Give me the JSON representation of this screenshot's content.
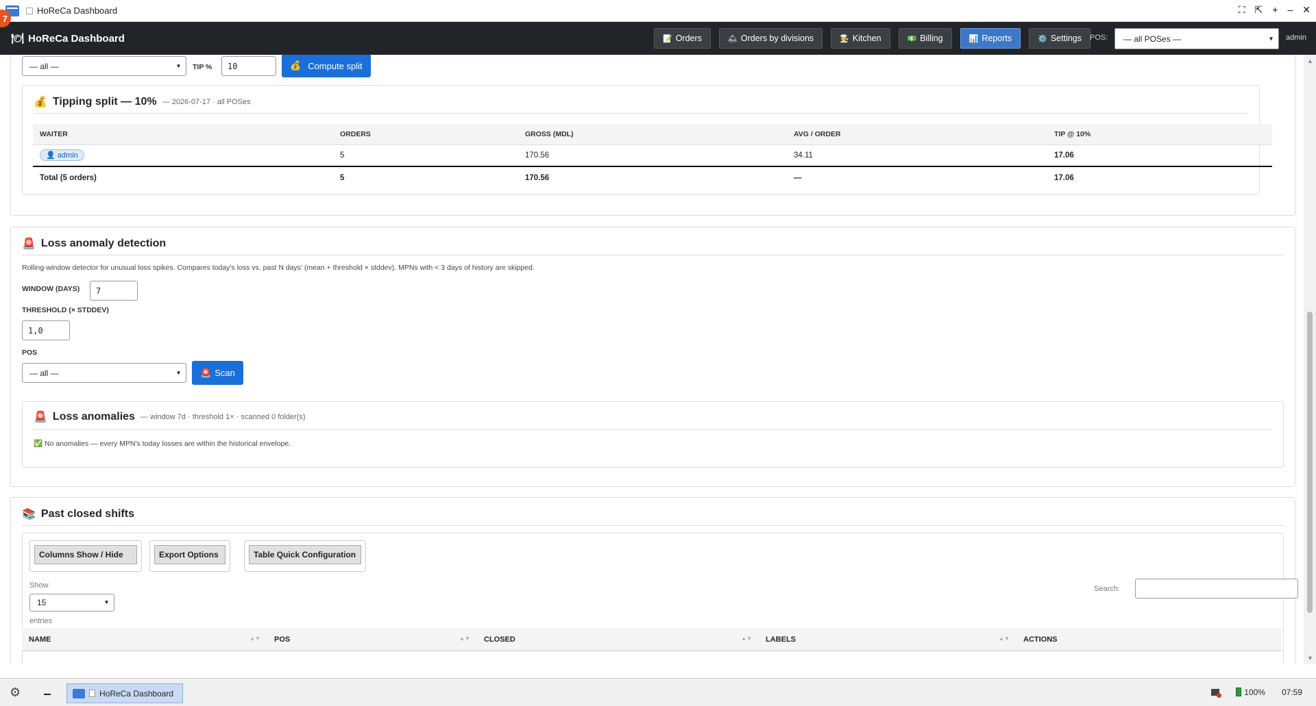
{
  "os": {
    "window_title": "HoReCa Dashboard",
    "notification_count": "7",
    "controls": [
      "⛶",
      "⇱",
      "+",
      "–",
      "✕"
    ]
  },
  "navbar": {
    "brand": "HoReCa Dashboard",
    "buttons": [
      {
        "label": "Orders",
        "icon": "📝"
      },
      {
        "label": "Orders by divisions",
        "icon": "🛎"
      },
      {
        "label": "Kitchen",
        "icon": "👨‍🍳"
      },
      {
        "label": "Billing",
        "icon": "💵"
      },
      {
        "label": "Reports",
        "icon": "📊",
        "active": true
      },
      {
        "label": "Settings",
        "icon": "⚙️"
      }
    ],
    "pos_label": "POS:",
    "pos_value": "— all POSes —",
    "user": "admin"
  },
  "tipping_controls": {
    "pos_value": "— all —",
    "tip_label": "TIP %",
    "tip_value": "10",
    "compute_button": "Compute split",
    "compute_icon": "💰"
  },
  "tipping_split": {
    "icon": "💰",
    "title": "Tipping split — 10%",
    "subtitle": "— 2026-07-17 · all POSes",
    "columns": [
      "WAITER",
      "ORDERS",
      "GROSS (MDL)",
      "AVG / ORDER",
      "TIP @ 10%"
    ],
    "rows": [
      {
        "waiter": "admin",
        "orders": "5",
        "gross": "170.56",
        "avg": "34.11",
        "tip": "17.06"
      }
    ],
    "total": {
      "label": "Total (5 orders)",
      "orders": "5",
      "gross": "170.56",
      "avg": "—",
      "tip": "17.06"
    }
  },
  "loss_anomaly": {
    "icon": "🚨",
    "title": "Loss anomaly detection",
    "description": "Rolling-window detector for unusual loss spikes. Compares today's loss vs. past N days' (mean + threshold × stddev). MPNs with < 3 days of history are skipped.",
    "window_label": "WINDOW (DAYS)",
    "window_value": "7",
    "threshold_label": "THRESHOLD (× STDDEV)",
    "threshold_value": "1,0",
    "pos_label": "POS",
    "pos_value": "— all —",
    "scan_button": "Scan",
    "scan_icon": "🚨"
  },
  "loss_anomalies": {
    "icon": "🚨",
    "title": "Loss anomalies",
    "subtitle": "— window 7d · threshold 1× · scanned 0 folder(s)",
    "message_icon": "✅",
    "message": "No anomalies — every MPN's today losses are within the historical envelope."
  },
  "past_shifts": {
    "icon": "📚",
    "title": "Past closed shifts",
    "buttons": [
      "Columns Show / Hide",
      "Export Options",
      "Table Quick Configuration"
    ],
    "show_label": "Show",
    "show_value": "15",
    "entries_label": "entries",
    "search_label": "Search:",
    "search_value": "",
    "columns": [
      "NAME",
      "POS",
      "CLOSED",
      "LABELS",
      "ACTIONS"
    ]
  },
  "taskbar": {
    "task_label": "HoReCa Dashboard",
    "battery": "100%",
    "clock": "07:59"
  }
}
